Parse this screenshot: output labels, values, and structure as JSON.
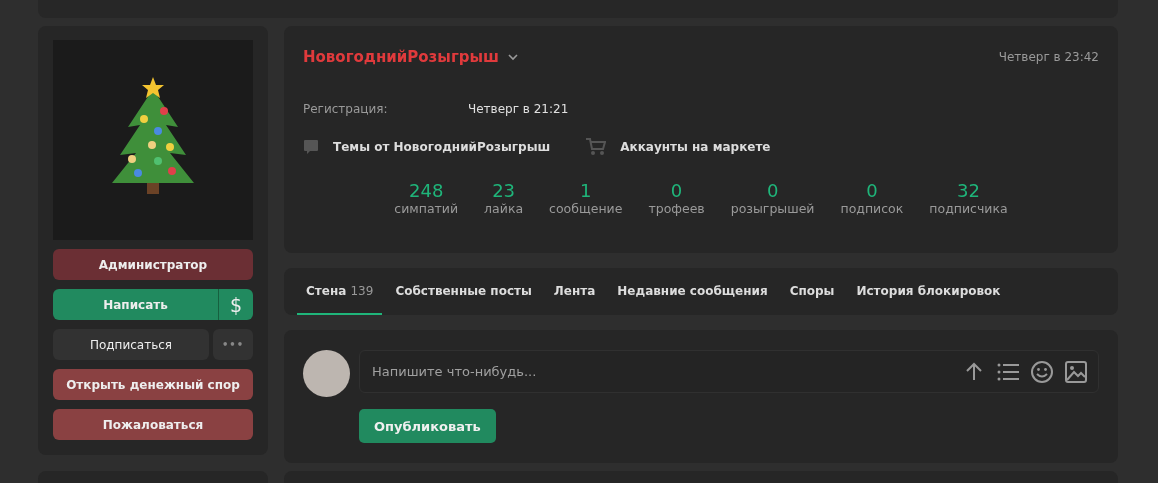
{
  "sidebar": {
    "buttons": [
      {
        "kind": "role",
        "label": "Администратор"
      },
      {
        "kind": "split",
        "label": "Написать",
        "extra": "$"
      },
      {
        "kind": "subscribe",
        "label": "Подписаться",
        "extra": "•••"
      },
      {
        "kind": "danger",
        "label": "Открыть денежный спор"
      },
      {
        "kind": "danger",
        "label": "Пожаловаться"
      }
    ]
  },
  "profile": {
    "username": "НовогоднийРозыгрыш",
    "last_seen": "Четверг в 23:42",
    "fields": [
      {
        "label": "Регистрация:",
        "value": "Четверг в 21:21"
      }
    ],
    "links": [
      {
        "kind": "topics",
        "label": "Темы от НовогоднийРозыгрыш"
      },
      {
        "kind": "market",
        "label": "Аккаунты на маркете"
      }
    ],
    "stats": [
      {
        "value": "248",
        "label": "симпатий"
      },
      {
        "value": "23",
        "label": "лайка"
      },
      {
        "value": "1",
        "label": "сообщение"
      },
      {
        "value": "0",
        "label": "трофеев"
      },
      {
        "value": "0",
        "label": "розыгрышей"
      },
      {
        "value": "0",
        "label": "подписок"
      },
      {
        "value": "32",
        "label": "подписчика"
      }
    ]
  },
  "tabs": [
    {
      "label": "Стена",
      "count": "139",
      "selected": true
    },
    {
      "label": "Собственные посты",
      "selected": false
    },
    {
      "label": "Лента",
      "selected": false
    },
    {
      "label": "Недавние сообщения",
      "selected": false
    },
    {
      "label": "Споры",
      "selected": false
    },
    {
      "label": "История блокировок",
      "selected": false
    }
  ],
  "composer": {
    "placeholder": "Напишите что-нибудь...",
    "submit": "Опубликовать"
  }
}
